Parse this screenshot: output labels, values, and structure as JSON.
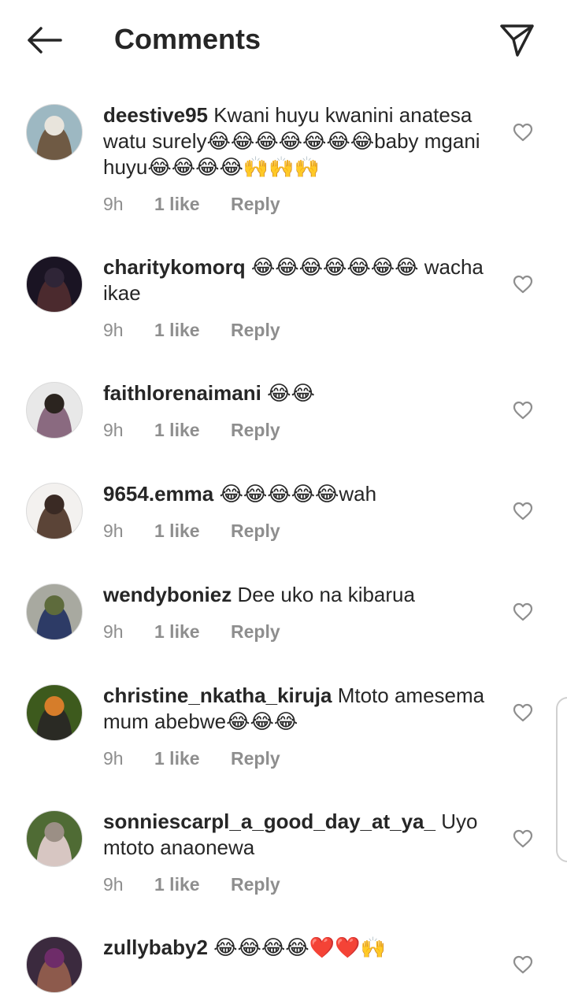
{
  "header": {
    "title": "Comments",
    "back_icon": "arrow-left-icon",
    "send_icon": "paper-plane-icon"
  },
  "comments": [
    {
      "username": "deestive95",
      "text": "Kwani huyu kwanini anatesa watu surely😂😂😂😂😂😂😂baby mgani huyu😂😂😂😂🙌🙌🙌",
      "time": "9h",
      "likes": "1 like",
      "reply": "Reply",
      "avatar_colors": [
        "#9db8c2",
        "#e8e4dc",
        "#6f5a44"
      ]
    },
    {
      "username": "charitykomorq",
      "text": "😂😂😂😂😂😂😂 wacha ikae",
      "time": "9h",
      "likes": "1 like",
      "reply": "Reply",
      "avatar_colors": [
        "#1a1423",
        "#2f2537",
        "#4b2a2e"
      ]
    },
    {
      "username": "faithlorenaimani",
      "text": "😂😂",
      "time": "9h",
      "likes": "1 like",
      "reply": "Reply",
      "avatar_colors": [
        "#e8e8e8",
        "#2b241f",
        "#8a6a80"
      ]
    },
    {
      "username": "9654.emma",
      "text": "😂😂😂😂😂wah",
      "time": "9h",
      "likes": "1 like",
      "reply": "Reply",
      "avatar_colors": [
        "#f3f1ef",
        "#3a2a24",
        "#5b4437"
      ]
    },
    {
      "username": "wendyboniez",
      "text": "Dee uko na kibarua",
      "time": "9h",
      "likes": "1 like",
      "reply": "Reply",
      "avatar_colors": [
        "#a8a9a0",
        "#5e6b3c",
        "#2d3b66"
      ]
    },
    {
      "username": "christine_nkatha_kiruja",
      "text": "Mtoto amesema mum abebwe😂😂😂",
      "time": "9h",
      "likes": "1 like",
      "reply": "Reply",
      "avatar_colors": [
        "#3d5a1d",
        "#d67d2a",
        "#2a2a24"
      ]
    },
    {
      "username": "sonniescarpl_a_good_day_at_ya_",
      "text": "Uyo mtoto anaonewa",
      "time": "9h",
      "likes": "1 like",
      "reply": "Reply",
      "avatar_colors": [
        "#4f6b34",
        "#9b8f85",
        "#d7c6c2"
      ]
    },
    {
      "username": "zullybaby2",
      "text": "😂😂😂😂❤️❤️🙌",
      "time": "",
      "likes": "",
      "reply": "",
      "avatar_colors": [
        "#3b2a3e",
        "#6e2c69",
        "#8d5a4c"
      ]
    }
  ],
  "colors": {
    "text": "#262626",
    "meta": "#8e8e8e",
    "background": "#ffffff"
  }
}
